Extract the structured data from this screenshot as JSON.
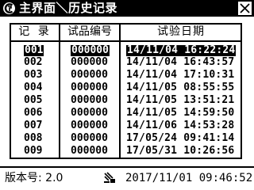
{
  "title_bar": {
    "logo_icon": "instrument-logo-icon",
    "title": "主界面＼历史记录",
    "close_icon": "close-icon"
  },
  "table": {
    "headers": {
      "record": "记 录",
      "sample_number": "试品编号",
      "test_date": "试验日期"
    },
    "selected_row": 0,
    "rows": [
      {
        "record": "001",
        "sample": "000000",
        "date": "14/11/04 16:22:24"
      },
      {
        "record": "002",
        "sample": "000000",
        "date": "14/11/04 16:43:57"
      },
      {
        "record": "003",
        "sample": "000000",
        "date": "14/11/04 17:10:31"
      },
      {
        "record": "004",
        "sample": "000000",
        "date": "14/11/05 08:55:55"
      },
      {
        "record": "005",
        "sample": "000000",
        "date": "14/11/05 13:51:21"
      },
      {
        "record": "006",
        "sample": "000000",
        "date": "14/11/05 14:59:50"
      },
      {
        "record": "007",
        "sample": "000000",
        "date": "14/11/06 14:53:28"
      },
      {
        "record": "008",
        "sample": "000000",
        "date": "17/05/24 09:41:14"
      },
      {
        "record": "009",
        "sample": "000000",
        "date": "17/05/31 10:26:56"
      }
    ]
  },
  "status_bar": {
    "version": "版本号: 2.0",
    "network_icon": "network-icon",
    "datetime": "2017/11/01 09:46:52"
  },
  "colors": {
    "foreground": "#000000",
    "background": "#ffffff"
  }
}
